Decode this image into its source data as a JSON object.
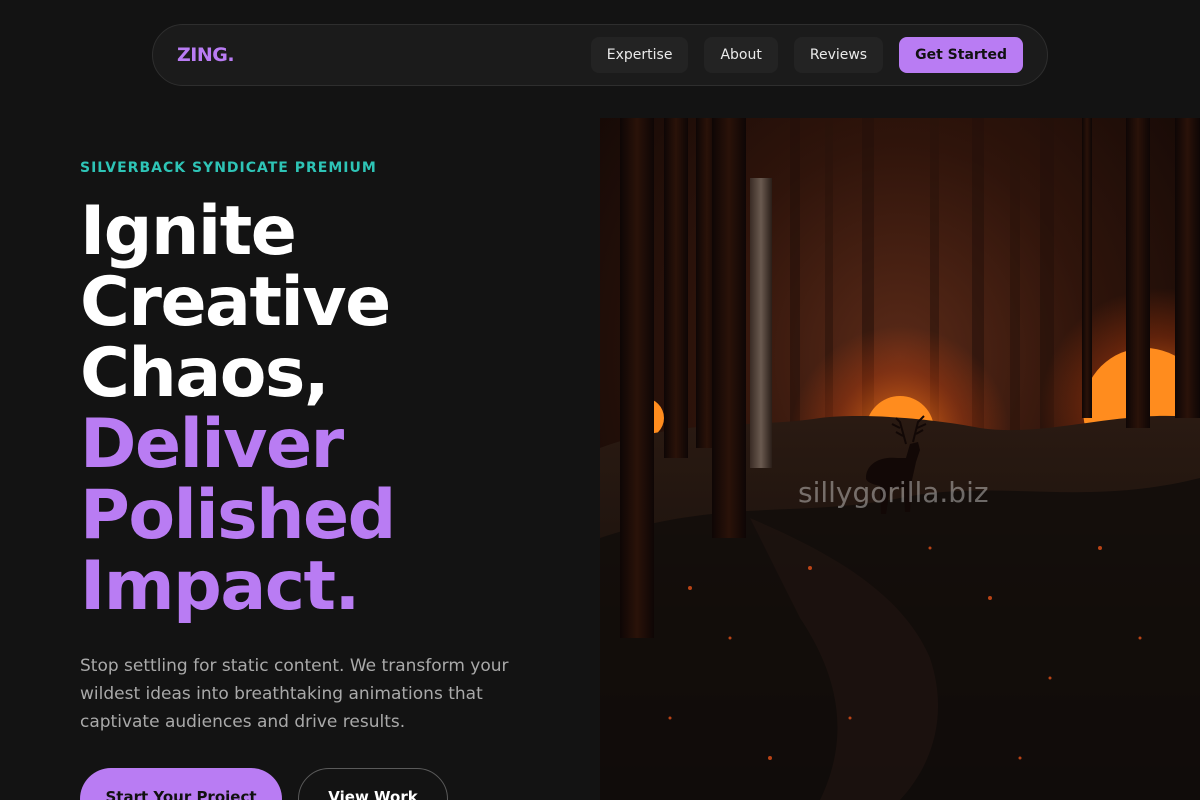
{
  "nav": {
    "logo": "ZING.",
    "links": [
      "Expertise",
      "About",
      "Reviews"
    ],
    "cta": "Get Started"
  },
  "hero": {
    "eyebrow": "SILVERBACK SYNDICATE PREMIUM",
    "headline_white": [
      "Ignite",
      "Creative",
      "Chaos,"
    ],
    "headline_purple": [
      "Deliver",
      "Polished",
      "Impact."
    ],
    "lede": "Stop settling for static content. We transform your wildest ideas into breathtaking animations that captivate audiences and drive results.",
    "primary_button": "Start Your Project",
    "secondary_button": "View Work",
    "image_watermark": "sillygorilla.biz"
  },
  "colors": {
    "background": "#131313",
    "accent": "#b97cf3",
    "eyebrow": "#2ec4b6"
  }
}
